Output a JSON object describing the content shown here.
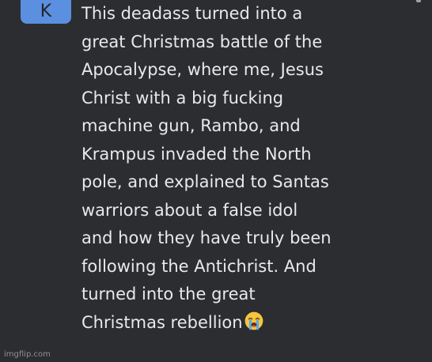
{
  "avatar": {
    "initial": "K",
    "color": "#5b8fe0"
  },
  "comment": {
    "lines": [
      "This deadass turned into a",
      "great Christmas battle of the",
      "Apocalypse, where me, Jesus",
      "Christ with a big fucking",
      "machine gun, Rambo, and",
      "Krampus invaded the North",
      "pole, and explained to Santas",
      "warriors about a false idol",
      "and how they have truly been",
      "following the Antichrist. And",
      "turned into the great",
      "Christmas rebellion"
    ],
    "trailing_emoji": "loudly-crying-face-icon"
  },
  "watermark": "imgflip.com",
  "colors": {
    "background": "#2c2d31",
    "text": "#e8e9ec"
  }
}
